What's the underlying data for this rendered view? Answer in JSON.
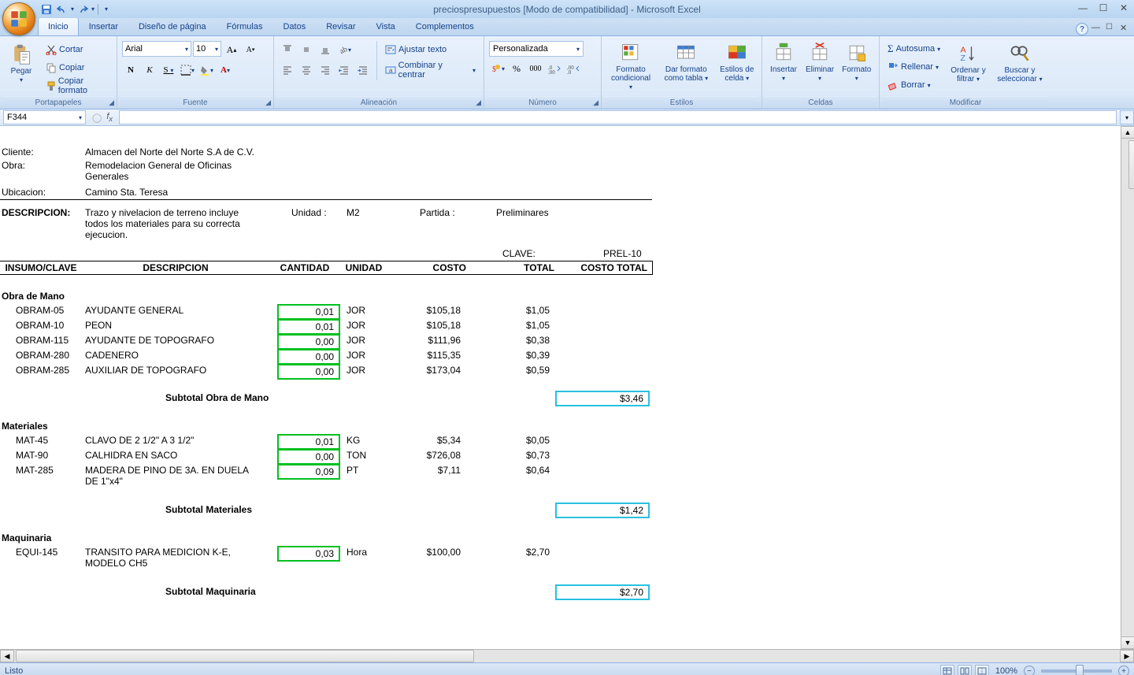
{
  "title": "preciospresupuestos  [Modo de compatibilidad] - Microsoft Excel",
  "tabs": [
    "Inicio",
    "Insertar",
    "Diseño de página",
    "Fórmulas",
    "Datos",
    "Revisar",
    "Vista",
    "Complementos"
  ],
  "active_tab": 0,
  "clipboard": {
    "paste": "Pegar",
    "cut": "Cortar",
    "copy": "Copiar",
    "format_painter": "Copiar formato",
    "label": "Portapapeles"
  },
  "font": {
    "name": "Arial",
    "size": "10",
    "label": "Fuente"
  },
  "alignment": {
    "wrap": "Ajustar texto",
    "merge": "Combinar y centrar",
    "label": "Alineación"
  },
  "number": {
    "selected": "Personalizada",
    "label": "Número"
  },
  "styles": {
    "cond": "Formato condicional",
    "table": "Dar formato como tabla",
    "cell": "Estilos de celda",
    "label": "Estilos"
  },
  "cells": {
    "insert": "Insertar",
    "delete": "Eliminar",
    "format": "Formato",
    "label": "Celdas"
  },
  "editing": {
    "sum": "Autosuma",
    "fill": "Rellenar",
    "clear": "Borrar",
    "sort": "Ordenar y filtrar",
    "find": "Buscar y seleccionar",
    "label": "Modificar"
  },
  "namebox": "F344",
  "sheet": {
    "cliente_label": "Cliente:",
    "cliente": "Almacen del Norte del Norte S.A de C.V.",
    "obra_label": "Obra:",
    "obra": "Remodelacion General de Oficinas Generales",
    "ubicacion_label": "Ubicacion:",
    "ubicacion": "Camino Sta. Teresa",
    "descripcion_label": "DESCRIPCION:",
    "descripcion_text": "Trazo y nivelacion de terreno incluye todos los materiales para su correcta ejecucion.",
    "unidad_label": "Unidad :",
    "unidad": "M2",
    "partida_label": "Partida :",
    "partida": "Preliminares",
    "clave_label": "CLAVE:",
    "clave": "PREL-10",
    "cols": {
      "insumo": "INSUMO/CLAVE",
      "desc": "DESCRIPCION",
      "cant": "CANTIDAD",
      "unid": "UNIDAD",
      "costo": "COSTO",
      "total": "TOTAL",
      "costo_total": "COSTO TOTAL"
    },
    "sec_obra": "Obra de Mano",
    "sec_mat": "Materiales",
    "sec_maq": "Maquinaria",
    "sub_obra": "Subtotal Obra de Mano",
    "sub_obra_val": "$3,46",
    "sub_mat": "Subtotal Materiales",
    "sub_mat_val": "$1,42",
    "sub_maq": "Subtotal Maquinaria",
    "sub_maq_val": "$2,70",
    "obra_rows": [
      {
        "clave": "OBRAM-05",
        "desc": "AYUDANTE GENERAL",
        "cant": "0,01",
        "unid": "JOR",
        "costo": "$105,18",
        "tot": "$1,05"
      },
      {
        "clave": "OBRAM-10",
        "desc": "PEON",
        "cant": "0,01",
        "unid": "JOR",
        "costo": "$105,18",
        "tot": "$1,05"
      },
      {
        "clave": "OBRAM-115",
        "desc": "AYUDANTE DE TOPOGRAFO",
        "cant": "0,00",
        "unid": "JOR",
        "costo": "$111,96",
        "tot": "$0,38"
      },
      {
        "clave": "OBRAM-280",
        "desc": "CADENERO",
        "cant": "0,00",
        "unid": "JOR",
        "costo": "$115,35",
        "tot": "$0,39"
      },
      {
        "clave": "OBRAM-285",
        "desc": "AUXILIAR DE TOPOGRAFO",
        "cant": "0,00",
        "unid": "JOR",
        "costo": "$173,04",
        "tot": "$0,59"
      }
    ],
    "mat_rows": [
      {
        "clave": "MAT-45",
        "desc": "CLAVO DE 2 1/2\" A 3 1/2\"",
        "cant": "0,01",
        "unid": "KG",
        "costo": "$5,34",
        "tot": "$0,05"
      },
      {
        "clave": "MAT-90",
        "desc": "CALHIDRA EN SACO",
        "cant": "0,00",
        "unid": "TON",
        "costo": "$726,08",
        "tot": "$0,73"
      },
      {
        "clave": "MAT-285",
        "desc": "MADERA DE PINO DE 3A. EN DUELA DE 1\"x4\"",
        "cant": "0,09",
        "unid": "PT",
        "costo": "$7,11",
        "tot": "$0,64"
      }
    ],
    "maq_rows": [
      {
        "clave": "EQUI-145",
        "desc": "TRANSITO PARA MEDICION K-E, MODELO CH5",
        "cant": "0,03",
        "unid": "Hora",
        "costo": "$100,00",
        "tot": "$2,70"
      }
    ]
  },
  "status": {
    "ready": "Listo",
    "zoom": "100%"
  }
}
